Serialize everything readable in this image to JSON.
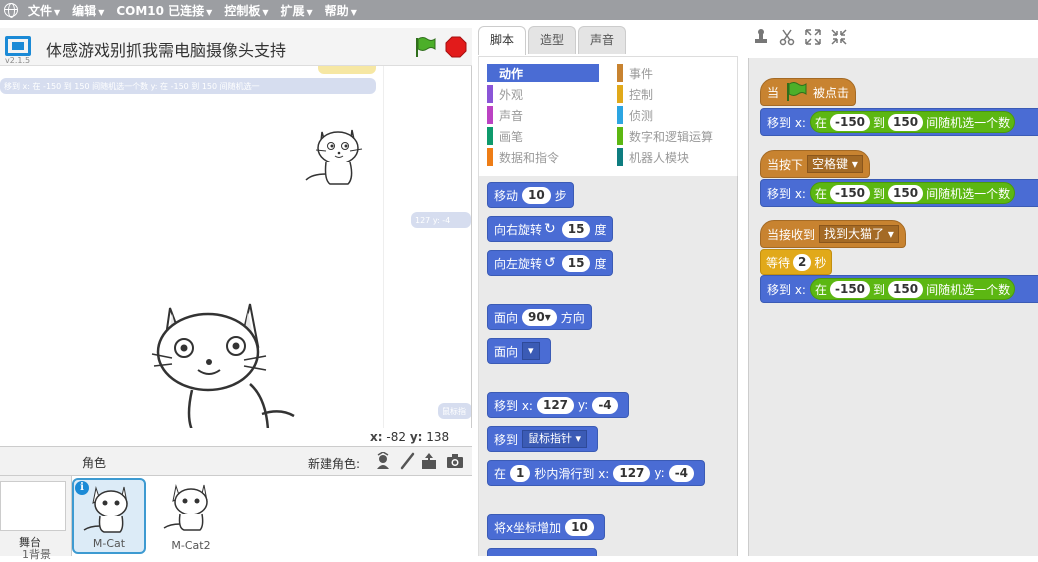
{
  "menu": {
    "items": [
      {
        "label": "文件"
      },
      {
        "label": "编辑"
      },
      {
        "label": "COM10 已连接"
      },
      {
        "label": "控制板"
      },
      {
        "label": "扩展"
      },
      {
        "label": "帮助"
      }
    ]
  },
  "stage": {
    "version": "v2.1.5",
    "title": "体感游戏别抓我需电脑摄像头支持",
    "ghost_text": "移到 x: 在 -150 到 150 间随机选一个数 y: 在 -150 到 150 间随机选一",
    "ghost_text2": "127 y: -4",
    "ghost_text3": "鼠标指",
    "coords": {
      "x_label": "x:",
      "x_value": "-82",
      "y_label": "y:",
      "y_value": "138"
    }
  },
  "sprites": {
    "header_label": "角色",
    "new_sprite_label": "新建角色:",
    "stage_label": "舞台",
    "stage_sub": "1背景",
    "list": [
      {
        "name": "M-Cat",
        "selected": true
      },
      {
        "name": "M-Cat2",
        "selected": false
      }
    ]
  },
  "tabs": [
    {
      "label": "脚本",
      "active": true
    },
    {
      "label": "造型",
      "active": false
    },
    {
      "label": "声音",
      "active": false
    }
  ],
  "categories": [
    {
      "label": "动作",
      "color": "#4a6cd4",
      "active": true
    },
    {
      "label": "外观",
      "color": "#8a55d7"
    },
    {
      "label": "声音",
      "color": "#bb42c3"
    },
    {
      "label": "画笔",
      "color": "#0e9a6c"
    },
    {
      "label": "数据和指令",
      "color": "#ee7d16"
    },
    {
      "label": "事件",
      "color": "#c88330"
    },
    {
      "label": "控制",
      "color": "#e1a91a"
    },
    {
      "label": "侦测",
      "color": "#2ca5e2"
    },
    {
      "label": "数字和逻辑运算",
      "color": "#5cb712"
    },
    {
      "label": "机器人模块",
      "color": "#0e7d80"
    }
  ],
  "palette": {
    "move": {
      "pre": "移动",
      "num": "10",
      "post": "步"
    },
    "turn_right": {
      "pre": "向右旋转",
      "num": "15",
      "post": "度"
    },
    "turn_left": {
      "pre": "向左旋转",
      "num": "15",
      "post": "度"
    },
    "point_dir": {
      "pre": "面向",
      "num": "90▾",
      "post": "方向"
    },
    "point_towards": {
      "pre": "面向",
      "dd": "▾"
    },
    "goto_xy": {
      "pre": "移到 x:",
      "x": "127",
      "mid": "y:",
      "y": "-4"
    },
    "goto": {
      "pre": "移到",
      "dd": "鼠标指针 ▾"
    },
    "glide": {
      "pre": "在",
      "secs": "1",
      "mid1": "秒内滑行到 x:",
      "x": "127",
      "mid2": "y:",
      "y": "-4"
    },
    "change_x": {
      "pre": "将x坐标增加",
      "num": "10"
    }
  },
  "script": {
    "hat1": {
      "pre": "当",
      "post": "被点击"
    },
    "goto_text": {
      "pre": "移到 x:",
      "in": "在",
      "from": "-150",
      "to_word": "到",
      "to": "150",
      "post": "间随机选一个数"
    },
    "hat2": {
      "pre": "当按下",
      "dd": "空格键 ▾"
    },
    "hat3": {
      "pre": "当接收到",
      "dd": "找到大猫了 ▾"
    },
    "wait": {
      "pre": "等待",
      "num": "2",
      "post": "秒"
    }
  },
  "colors": {
    "motion": "#4a6cd4",
    "events": "#c88330",
    "control": "#e1a91a",
    "operators": "#5cb712",
    "menubar": "#9c9ea2"
  }
}
